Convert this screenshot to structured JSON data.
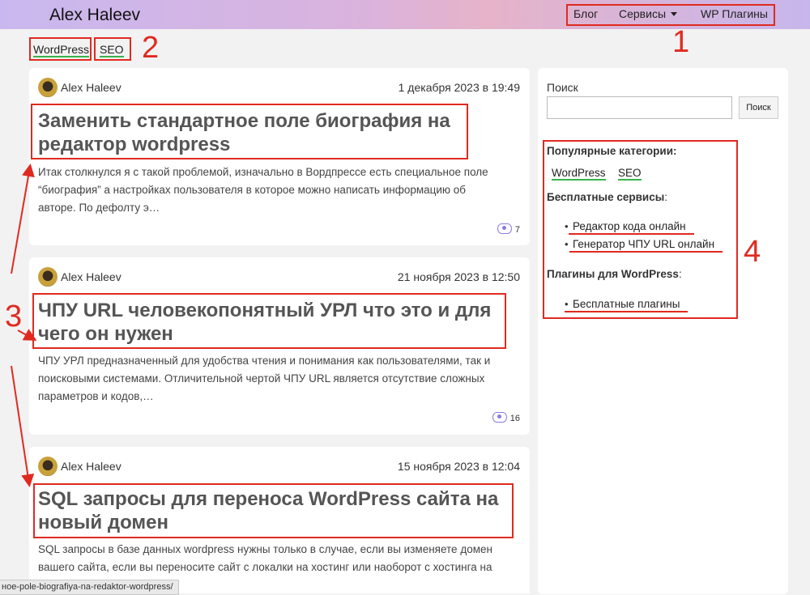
{
  "header": {
    "site_title": "Alex Haleev",
    "nav": [
      "Блог",
      "Сервисы",
      "WP Плагины"
    ]
  },
  "annotations": [
    "1",
    "2",
    "3",
    "4"
  ],
  "tags": [
    "WordPress",
    "SEO"
  ],
  "posts": [
    {
      "author": "Alex Haleev",
      "date": "1 декабря 2023 в 19:49",
      "title_lines": [
        "Заменить стандартное поле биография на",
        "редактор wordpress"
      ],
      "excerpt_lines": [
        "Итак столкнулся я с такой проблемой, изначально в Вордпрессе есть специальное поле",
        "“биография” а настройках пользователя в которое можно написать информацию об",
        "авторе. По дефолту э…"
      ],
      "views": "7"
    },
    {
      "author": "Alex Haleev",
      "date": "21 ноября 2023 в 12:50",
      "title_lines": [
        "ЧПУ URL человекопонятный УРЛ что это и для",
        "чего он нужен"
      ],
      "excerpt_lines": [
        "ЧПУ УРЛ предназначенный для удобства чтения и понимания как пользователями, так и",
        "поисковыми системами. Отличительной чертой ЧПУ URL является отсутствие сложных",
        "параметров и кодов,…"
      ],
      "views": "16"
    },
    {
      "author": "Alex Haleev",
      "date": "15 ноября 2023 в 12:04",
      "title_lines": [
        "SQL запросы для переноса WordPress сайта на",
        "новый домен"
      ],
      "excerpt_lines": [
        "SQL запросы в базе данных wordpress нужны только в случае, если вы изменяете домен",
        "вашего сайта, если вы переносите сайт с локалки на хостинг или наоборот с хостинга на"
      ]
    }
  ],
  "sidebar": {
    "search_label": "Поиск",
    "search_value": "",
    "search_button": "Поиск",
    "popular_title": "Популярные категории:",
    "popular": [
      "WordPress",
      "SEO"
    ],
    "free_services_title": "Бесплатные сервисы",
    "services": [
      "Редактор кода онлайн",
      "Генератор ЧПУ URL онлайн"
    ],
    "plugins_title": "Плагины для WordPress",
    "plugins": [
      "Бесплатные плагины"
    ]
  },
  "status_url": "ное-pole-biografiya-na-redaktor-wordpress/",
  "colors": {
    "annotation": "#e02a20",
    "tag_underline": "#36b44a",
    "icon": "#8b7be0"
  }
}
